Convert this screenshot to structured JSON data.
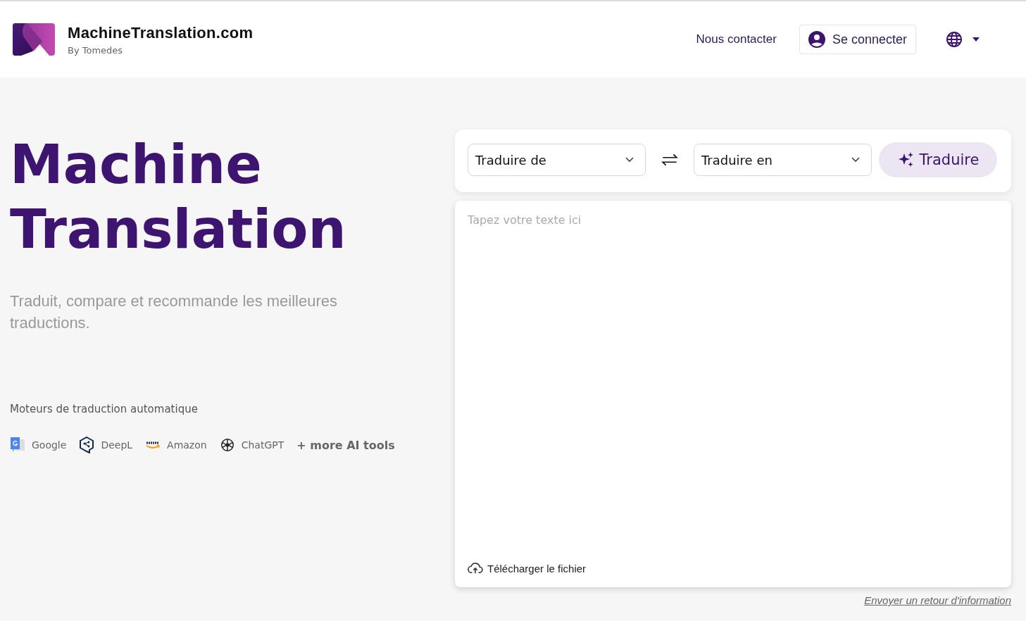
{
  "header": {
    "brand": "MachineTranslation.com",
    "byline": "By Tomedes",
    "contact": "Nous contacter",
    "login": "Se connecter"
  },
  "hero": {
    "title_lines": [
      "Machine",
      "Translation"
    ],
    "subtitle": "Traduit, compare et recommande les meilleures traductions.",
    "engines_heading": "Moteurs de traduction automatique",
    "engines": [
      {
        "kind": "google",
        "name": "Google"
      },
      {
        "kind": "deepl",
        "name": "DeepL"
      },
      {
        "kind": "aws",
        "name": "Amazon"
      },
      {
        "kind": "chatgpt",
        "name": "ChatGPT"
      }
    ],
    "more": "+ more AI tools"
  },
  "translator": {
    "source": {
      "placeholder": "Traduire de"
    },
    "target": {
      "placeholder": "Traduire en"
    },
    "translate": "Traduire",
    "text": {
      "placeholder": "Tapez votre texte ici"
    },
    "upload": "Télécharger le fichier"
  },
  "feedback": "Envoyer un retour d'information"
}
